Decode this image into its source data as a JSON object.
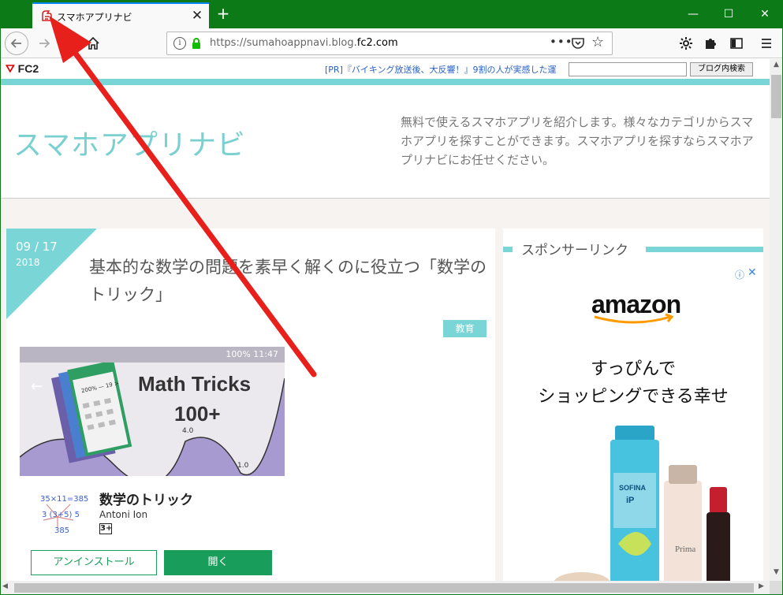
{
  "browser": {
    "tab_title": "スマホアプリナビ",
    "tab_close": "✕",
    "new_tab": "+",
    "window_min": "—",
    "window_max": "☐",
    "window_close": "✕",
    "url_prefix": "https://sumahoappnavi.blog.",
    "url_domain": "fc2.com",
    "url_actions": "•••",
    "accent_color": "#0a84ff",
    "titlebar_color": "#0c7a17"
  },
  "fc2_bar": {
    "logo": "FC2",
    "pr_text": "[PR]『バイキング放送後、大反響！』9割の人が実感した運",
    "search_placeholder": "",
    "search_button": "ブログ内検索"
  },
  "blog": {
    "title": "スマホアプリナビ",
    "description": "無料で使えるスマホアプリを紹介します。様々なカテゴリからスマホアプリを探すことができます。スマホアプリを探すならスマホアプリナビにお任せください。",
    "accent_color": "#79d5d6"
  },
  "article": {
    "date_md": "09 / 17",
    "date_year": "2018",
    "title": "基本的な数学の問題を素早く解くのに役立つ「数学のトリック」",
    "tag": "教育",
    "screenshot": {
      "status": "100% 11:47",
      "title": "Math Tricks",
      "count": "100+",
      "label_40": "4.0",
      "label_10": "1.0"
    },
    "app": {
      "name": "数学のトリック",
      "developer": "Antoni Ion",
      "rating": "3+",
      "logo_line1": "35×11=385",
      "logo_line2": "3 (3+5) 5",
      "logo_line3": "385",
      "uninstall_label": "アンインストール",
      "open_label": "開く",
      "button_color": "#189e5a"
    }
  },
  "sidebar": {
    "heading": "スポンサーリンク",
    "ad": {
      "info": "ⓘ",
      "close": "✕",
      "brand": "amazon",
      "line1": "すっぴんで",
      "line2": "ショッピングできる幸せ",
      "product_label_1": "SOFINA",
      "product_label_2": "iP",
      "product_label_3": "Prima"
    }
  }
}
